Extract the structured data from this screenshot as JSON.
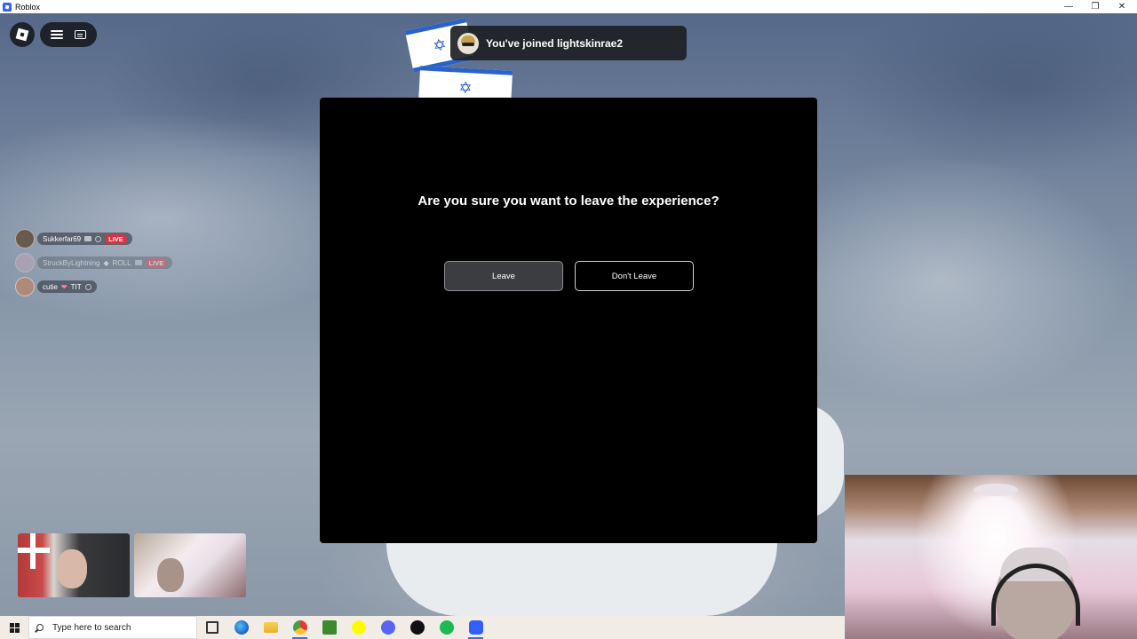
{
  "window": {
    "title": "Roblox",
    "controls": [
      "minimize",
      "restore",
      "close"
    ]
  },
  "toast": {
    "message": "You've joined lightskinrae2"
  },
  "players": [
    {
      "name": "Sukkerfar69",
      "badge": "LIVE",
      "faded": false
    },
    {
      "name": "StruckByLightning",
      "tag": "ROLL",
      "badge": "LIVE",
      "faded": true
    },
    {
      "name": "cutie",
      "tag": "TIT",
      "badge": "",
      "faded": false
    }
  ],
  "dialog": {
    "question": "Are you sure you want to leave the experience?",
    "leave_label": "Leave",
    "stay_label": "Don't Leave"
  },
  "taskbar": {
    "search_placeholder": "Type here to search",
    "apps": [
      "task-view",
      "edge",
      "file-explorer",
      "chrome",
      "minecraft",
      "snapchat",
      "discord",
      "roblox-studio",
      "spotify",
      "roblox"
    ]
  },
  "colors": {
    "accent_live": "#d9323c",
    "modal_bg": "#000000",
    "taskbar_bg": "#f1ede6"
  }
}
